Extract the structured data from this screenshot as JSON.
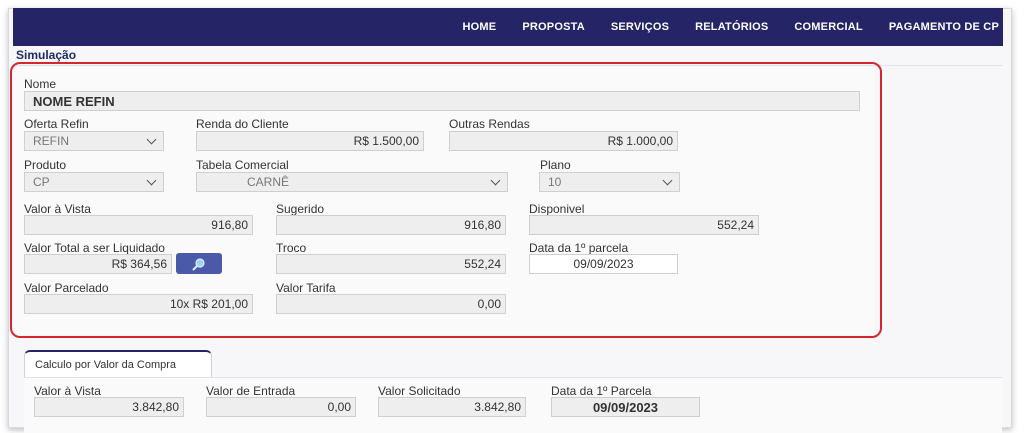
{
  "nav": {
    "items": [
      "HOME",
      "PROPOSTA",
      "SERVIÇOS",
      "RELATÓRIOS",
      "COMERCIAL",
      "PAGAMENTO DE CP"
    ]
  },
  "section": {
    "title": "Simulação"
  },
  "form": {
    "nome": {
      "label": "Nome",
      "value": "NOME REFIN"
    },
    "oferta": {
      "label": "Oferta Refin",
      "value": "REFIN"
    },
    "renda": {
      "label": "Renda do Cliente",
      "value": "R$ 1.500,00"
    },
    "outras": {
      "label": "Outras Rendas",
      "value": "R$ 1.000,00"
    },
    "produto": {
      "label": "Produto",
      "value": "CP"
    },
    "tabela": {
      "label": "Tabela Comercial",
      "value": "CARNÊ"
    },
    "plano": {
      "label": "Plano",
      "value": "10"
    },
    "valor_vista": {
      "label": "Valor à Vista",
      "value": "916,80"
    },
    "sugerido": {
      "label": "Sugerido",
      "value": "916,80"
    },
    "disponivel": {
      "label": "Disponivel",
      "value": "552,24"
    },
    "liquidado": {
      "label": "Valor Total a ser Liquidado",
      "value": "R$ 364,56"
    },
    "troco": {
      "label": "Troco",
      "value": "552,24"
    },
    "data_parcela": {
      "label": "Data da 1º parcela",
      "value": "09/09/2023"
    },
    "parcelado": {
      "label": "Valor Parcelado",
      "value": "10x R$ 201,00"
    },
    "tarifa": {
      "label": "Valor Tarifa",
      "value": "0,00"
    }
  },
  "tab": {
    "label": "Calculo por Valor da Compra"
  },
  "compra": {
    "vista": {
      "label": "Valor à Vista",
      "value": "3.842,80"
    },
    "entrada": {
      "label": "Valor de Entrada",
      "value": "0,00"
    },
    "solicitado": {
      "label": "Valor Solicitado",
      "value": "3.842,80"
    },
    "data": {
      "label": "Data da 1º Parcela",
      "value": "09/09/2023"
    }
  },
  "colors": {
    "navbar": "#242467",
    "highlight": "#d5262d",
    "button": "#4a5aa8"
  }
}
